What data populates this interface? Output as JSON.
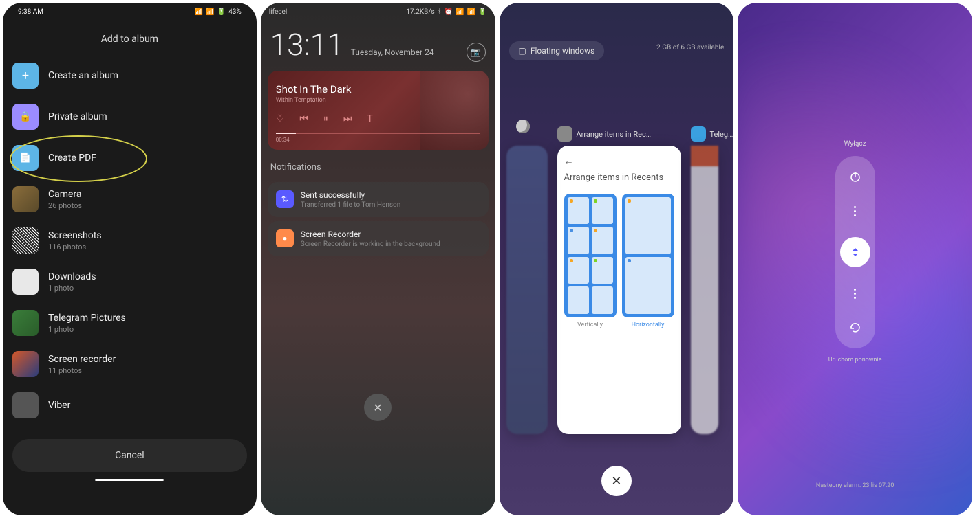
{
  "panel1": {
    "status": {
      "time": "9:38 AM",
      "battery": "43%"
    },
    "title": "Add to album",
    "create_album": "Create an album",
    "private_album": "Private album",
    "create_pdf": "Create PDF",
    "albums": [
      {
        "name": "Camera",
        "count": "26 photos"
      },
      {
        "name": "Screenshots",
        "count": "116 photos"
      },
      {
        "name": "Downloads",
        "count": "1 photo"
      },
      {
        "name": "Telegram Pictures",
        "count": "1 photo"
      },
      {
        "name": "Screen recorder",
        "count": "11 photos"
      },
      {
        "name": "Viber",
        "count": ""
      }
    ],
    "cancel": "Cancel"
  },
  "panel2": {
    "status": {
      "carrier": "lifecell",
      "speed": "17.2KB/s"
    },
    "time": "13:11",
    "date": "Tuesday, November 24",
    "music": {
      "source": "",
      "title": "Shot In The Dark",
      "artist": "Within Temptation",
      "elapsed": "00:34"
    },
    "notifications_header": "Notifications",
    "notifs": [
      {
        "title": "Sent successfully",
        "sub": "Transferred 1 file to Tom Henson",
        "time": ""
      },
      {
        "title": "Screen Recorder",
        "sub": "Screen Recorder is working in the background",
        "time": ""
      }
    ]
  },
  "panel3": {
    "floating_windows": "Floating windows",
    "memory": "2 GB of 6 GB available",
    "apps": [
      {
        "label": "Arrange items in Rec…"
      },
      {
        "label": "Teleg…"
      }
    ],
    "card": {
      "title": "Arrange items in Recents",
      "opt_vertical": "Vertically",
      "opt_horizontal": "Horizontally"
    }
  },
  "panel4": {
    "power_off": "Wyłącz",
    "restart": "Uruchom ponownie",
    "alarm": "Następny alarm: 23 lis 07:20"
  }
}
